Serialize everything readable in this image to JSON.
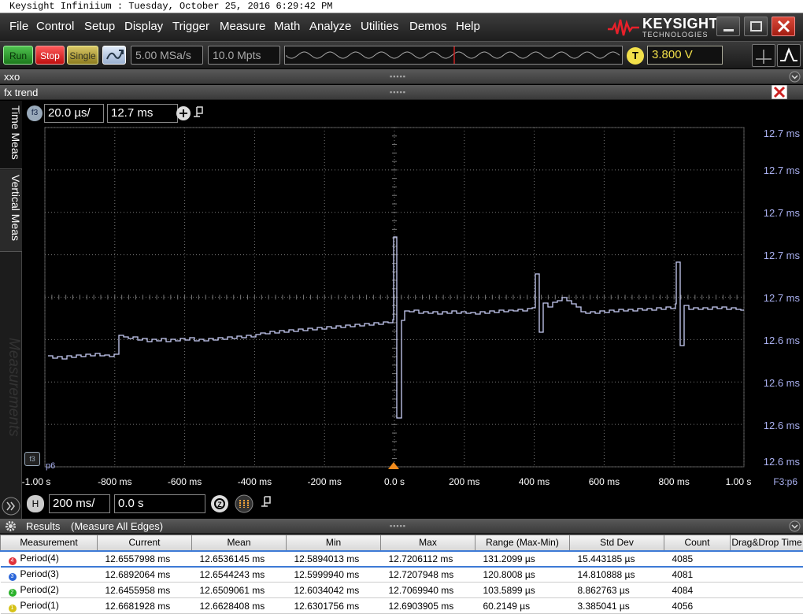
{
  "title_bar": "Keysight Infiniium : Tuesday, October 25, 2016 6:29:42 PM",
  "menu": [
    "File",
    "Control",
    "Setup",
    "Display",
    "Trigger",
    "Measure",
    "Math",
    "Analyze",
    "Utilities",
    "Demos",
    "Help"
  ],
  "logo": {
    "name": "KEYSIGHT",
    "sub": "TECHNOLOGIES"
  },
  "toolbar": {
    "run": "Run",
    "stop": "Stop",
    "single": "Single",
    "sample_rate": "5.00 MSa/s",
    "memory_depth": "10.0 Mpts",
    "trigger_badge": "T",
    "trigger_level": "3.800 V"
  },
  "panels": {
    "xxo": "xxo",
    "fx_trend": "fx trend"
  },
  "left_tabs": {
    "time_meas": "Time Meas",
    "vertical_meas": "Vertical Meas",
    "measurements": "Measurements"
  },
  "function": {
    "badge": "f3",
    "scale": "20.0 µs/",
    "offset": "12.7 ms",
    "marker_badge": "f3",
    "marker_label": "p6"
  },
  "horizontal": {
    "badge": "H",
    "scale": "200 ms/",
    "position": "0.0 s"
  },
  "plot": {
    "y_labels": [
      "12.7 ms",
      "12.7 ms",
      "12.7 ms",
      "12.7 ms",
      "12.7 ms",
      "12.6 ms",
      "12.6 ms",
      "12.6 ms",
      "12.6 ms"
    ],
    "x_labels": [
      "-1.00 s",
      "-800 ms",
      "-600 ms",
      "-400 ms",
      "-200 ms",
      "0.0 s",
      "200 ms",
      "400 ms",
      "600 ms",
      "800 ms",
      "1.00 s"
    ],
    "source_label": "F3:p6",
    "trace_color": "#c8cdf5",
    "grid_color": "#777777",
    "label_color": "#a9b0f0"
  },
  "results": {
    "header": "Results",
    "mode": "(Measure All Edges)",
    "columns": [
      "Measurement",
      "Current",
      "Mean",
      "Min",
      "Max",
      "Range (Max-Min)",
      "Std Dev",
      "Count",
      "Drag&Drop Time"
    ],
    "rows": [
      {
        "id": "4",
        "color": "#e0323c",
        "cells": [
          "Period(4)",
          "12.6557998 ms",
          "12.6536145 ms",
          "12.5894013 ms",
          "12.7206112 ms",
          "131.2099 µs",
          "15.443185 µs",
          "4085",
          ""
        ]
      },
      {
        "id": "3",
        "color": "#2b66d9",
        "cells": [
          "Period(3)",
          "12.6892064 ms",
          "12.6544243 ms",
          "12.5999940 ms",
          "12.7207948 ms",
          "120.8008 µs",
          "14.810888 µs",
          "4081",
          ""
        ]
      },
      {
        "id": "2",
        "color": "#2ab12a",
        "cells": [
          "Period(2)",
          "12.6455958 ms",
          "12.6509061 ms",
          "12.6034042 ms",
          "12.7069940 ms",
          "103.5899 µs",
          "8.862763 µs",
          "4084",
          ""
        ]
      },
      {
        "id": "1",
        "color": "#d6c218",
        "cells": [
          "Period(1)",
          "12.6681928 ms",
          "12.6628408 ms",
          "12.6301756 ms",
          "12.6903905 ms",
          "60.2149 µs",
          "3.385041 µs",
          "4056",
          ""
        ]
      }
    ]
  }
}
